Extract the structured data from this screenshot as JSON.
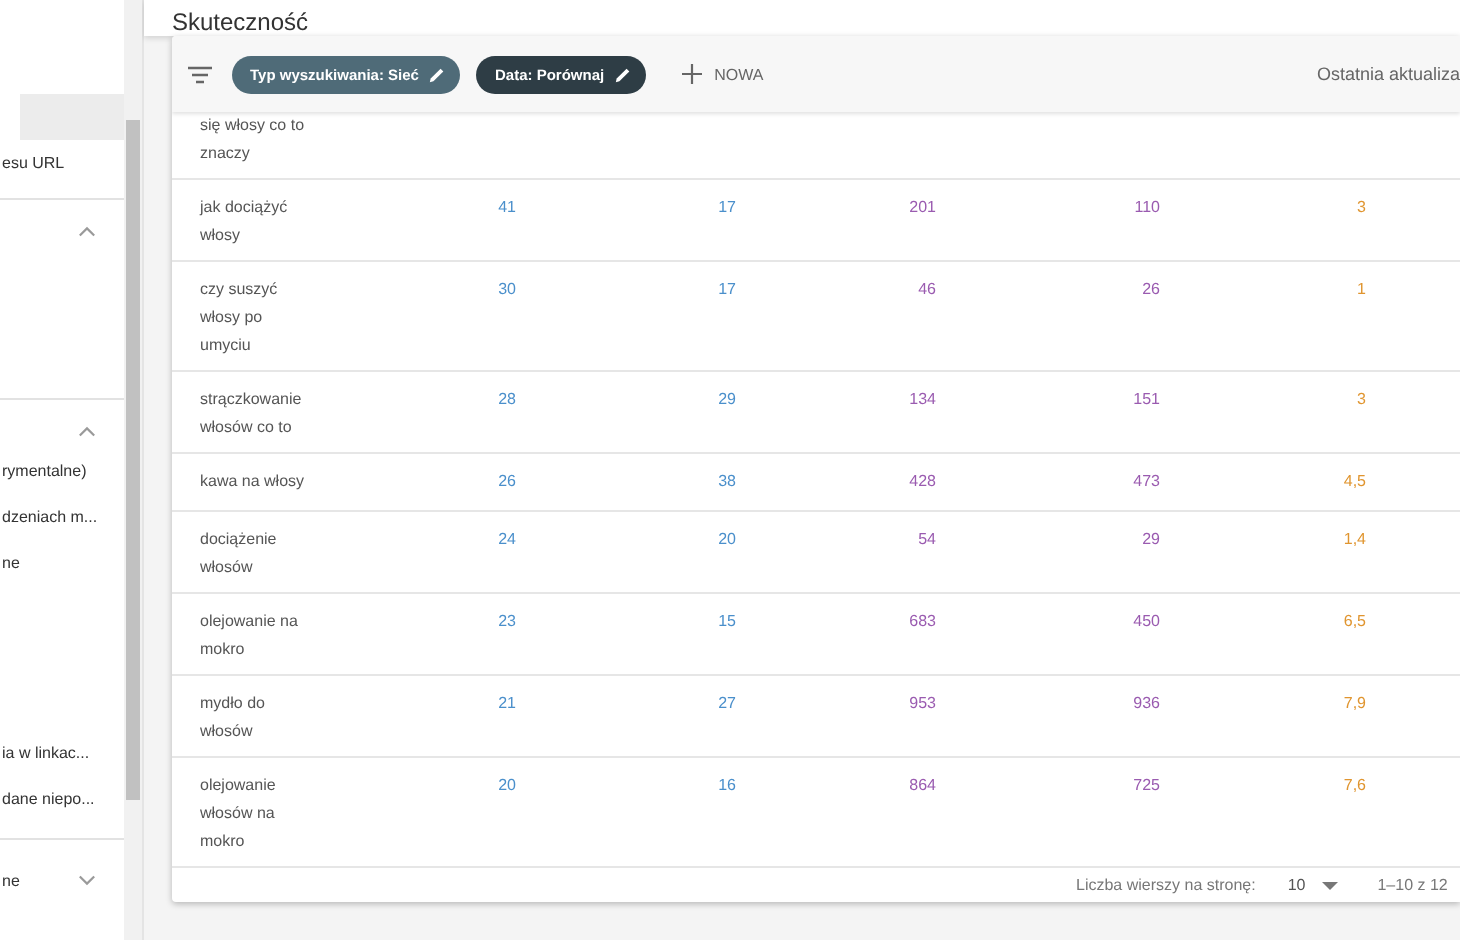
{
  "sidebar": {
    "sections": [
      {
        "items": [
          {
            "selected": true
          },
          {
            "label": "esu URL",
            "selected": false
          }
        ]
      },
      {
        "expanded": true
      },
      {
        "expanded": true,
        "items": [
          {
            "label": "rymentalne)",
            "selected": false
          },
          {
            "label": "dzeniach m...",
            "selected": false
          },
          {
            "label": "ne",
            "selected": false
          },
          {
            "label": "ia w linkac...",
            "selected": false
          },
          {
            "label": "dane niepo...",
            "selected": false
          }
        ]
      },
      {
        "label": "ne",
        "expanded": false
      }
    ]
  },
  "header": {
    "title": "Skuteczność"
  },
  "filters": {
    "chips": [
      {
        "label": "Typ wyszukiwania: Sieć",
        "color": "#4f6b78"
      },
      {
        "label": "Data: Porównaj",
        "color": "#2e3d45"
      }
    ],
    "new_button": "NOWA",
    "last_update": "Ostatnia aktualiza"
  },
  "table": {
    "metric_columns": [
      {
        "color": "#4a8fcb"
      },
      {
        "color": "#4a8fcb"
      },
      {
        "color": "#9a5bb0"
      },
      {
        "color": "#9a5bb0"
      },
      {
        "color": "#e0952f"
      }
    ],
    "rows": [
      {
        "keyword": "się włosy co to znaczy",
        "values": []
      },
      {
        "keyword": "jak dociążyć włosy",
        "values": [
          "41",
          "17",
          "201",
          "110",
          "3"
        ]
      },
      {
        "keyword": "czy suszyć włosy po umyciu",
        "values": [
          "30",
          "17",
          "46",
          "26",
          "1"
        ]
      },
      {
        "keyword": "strączkowanie włosów co to",
        "values": [
          "28",
          "29",
          "134",
          "151",
          "3"
        ]
      },
      {
        "keyword": "kawa na włosy",
        "values": [
          "26",
          "38",
          "428",
          "473",
          "4,5"
        ]
      },
      {
        "keyword": "dociążenie włosów",
        "values": [
          "24",
          "20",
          "54",
          "29",
          "1,4"
        ]
      },
      {
        "keyword": "olejowanie na mokro",
        "values": [
          "23",
          "15",
          "683",
          "450",
          "6,5"
        ]
      },
      {
        "keyword": "mydło do włosów",
        "values": [
          "21",
          "27",
          "953",
          "936",
          "7,9"
        ]
      },
      {
        "keyword": "olejowanie włosów na mokro",
        "values": [
          "20",
          "16",
          "864",
          "725",
          "7,6"
        ]
      }
    ]
  },
  "pagination": {
    "rows_per_page_label": "Liczba wierszy na stronę:",
    "rows_per_page": "10",
    "range": "1–10 z 12"
  }
}
